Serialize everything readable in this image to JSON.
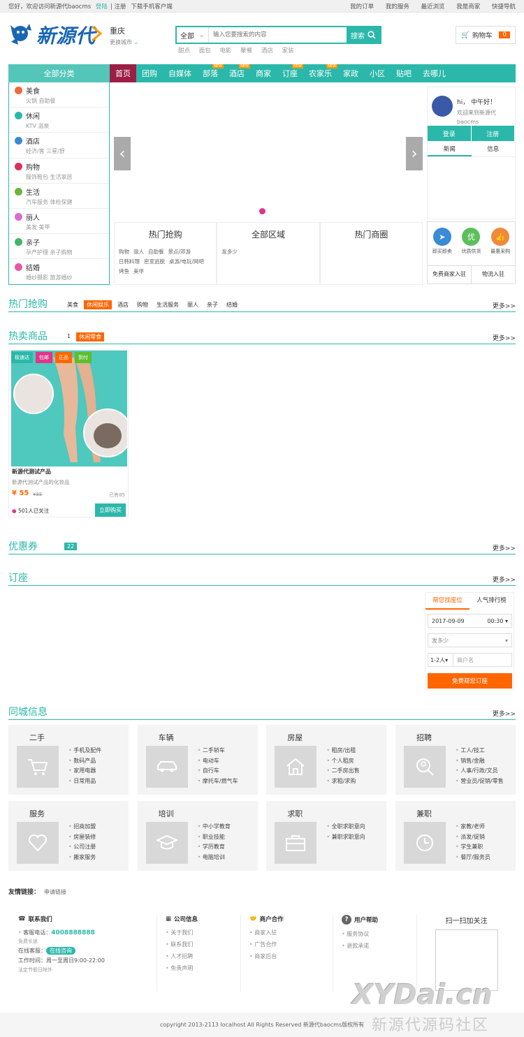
{
  "topbar": {
    "greet": "您好，欢迎访问新源代baocms",
    "login": "登陆",
    "register": "注册",
    "app": "下载手机客户端",
    "orders": "我的订单",
    "service": "我的服务",
    "recent": "最近浏览",
    "merchant": "我是商家",
    "quicknav": "快捷导航"
  },
  "header": {
    "logo": "新源代",
    "city": "重庆",
    "change_city": "更换城市",
    "search_cat": "全部",
    "search_placeholder": "输入您要搜索的内容",
    "search_btn": "搜索",
    "hotwords": [
      "甜点",
      "面包",
      "电影",
      "聚餐",
      "酒店",
      "家装"
    ],
    "cart": "购物车",
    "cart_count": "0"
  },
  "nav": {
    "all": "全部分类",
    "items": [
      "首页",
      "团购",
      "自媒体",
      "部落",
      "酒店",
      "商家",
      "订座",
      "农家乐",
      "家政",
      "小区",
      "贴吧",
      "去哪儿"
    ],
    "new_tag": "NEW"
  },
  "cats": [
    {
      "t": "美食",
      "s": "火锅  自助餐",
      "c": "#f06a35"
    },
    {
      "t": "休闲",
      "s": "KTV  温泉",
      "c": "#2bb8aa"
    },
    {
      "t": "酒店",
      "s": "经济/客  三星/舒",
      "c": "#3a8ad6"
    },
    {
      "t": "购物",
      "s": "服饰鞋包  生活家居",
      "c": "#d8335b"
    },
    {
      "t": "生活",
      "s": "汽车服务  体检保健",
      "c": "#6cb43c"
    },
    {
      "t": "丽人",
      "s": "美发  美甲",
      "c": "#d66cd4"
    },
    {
      "t": "亲子",
      "s": "孕产护理  亲子购物",
      "c": "#45b36b"
    },
    {
      "t": "结婚",
      "s": "婚纱摄影  旅游婚纱",
      "c": "#e957a5"
    }
  ],
  "trio": [
    {
      "h": "热门抢购",
      "k": [
        "购物",
        "丽人",
        "自助餐",
        "景点/郊游",
        "日韩料理",
        "密室逃脱",
        "桌游/电玩/网吧",
        "烤鱼",
        "美甲"
      ]
    },
    {
      "h": "全部区域",
      "k": [
        "发多少"
      ]
    },
    {
      "h": "热门商圈",
      "k": []
    }
  ],
  "user": {
    "hi": "hi，  中午好！",
    "welcome": "欢迎来到新源代baocms",
    "login": "登录",
    "register": "注册",
    "tab1": "新闻",
    "tab2": "信息"
  },
  "svc": {
    "items": [
      "即买即卖",
      "优质供货",
      "最惠采购"
    ],
    "you": "优",
    "b1": "免费商家入驻",
    "b2": "物流入驻"
  },
  "sections": {
    "hot": "热门抢购",
    "hot_tags": [
      "美食",
      "休闲娱乐",
      "酒店",
      "购物",
      "生活服务",
      "丽人",
      "亲子",
      "结婚"
    ],
    "sell": "热卖商品",
    "sell_num": "1",
    "sell_tag": "休闲零食",
    "coupon": "优惠券",
    "coupon_num": "22",
    "booking": "订座",
    "city": "同城信息",
    "more": "更多>>"
  },
  "product": {
    "badges": [
      "极速达",
      "包邮",
      "正品",
      "到付"
    ],
    "name": "新源代测试产品",
    "desc": "新源代测试产品的化妆品",
    "price": "¥ 55",
    "old": "¥85",
    "sold": "已售85",
    "follow": "501人已关注",
    "buy": "立即购买"
  },
  "booking": {
    "tab1": "帮您找座位",
    "tab2": "人气排行榜",
    "date": "2017-09-09",
    "time": "00:30",
    "area": "发多少",
    "people": "1-2人",
    "shop": "商户名",
    "go": "免费帮您订座"
  },
  "city": [
    {
      "t": "二手",
      "l": [
        "手机及配件",
        "数码产品",
        "家用电器",
        "日常用品"
      ]
    },
    {
      "t": "车辆",
      "l": [
        "二手轿车",
        "电动车",
        "自行车",
        "摩托车/燃气车"
      ]
    },
    {
      "t": "房屋",
      "l": [
        "租房/出租",
        "个人租房",
        "二手房出售",
        "求租/求购"
      ]
    },
    {
      "t": "招聘",
      "l": [
        "工人/技工",
        "销售/金融",
        "人事/行政/文员",
        "营业员/促销/零售"
      ]
    },
    {
      "t": "服务",
      "l": [
        "招商加盟",
        "房屋装修",
        "公司注册",
        "搬家服务"
      ]
    },
    {
      "t": "培训",
      "l": [
        "中小学教育",
        "职业技能",
        "学历教育",
        "电脑培训"
      ]
    },
    {
      "t": "求职",
      "l": [
        "全职求职意向",
        "兼职求职意向"
      ]
    },
    {
      "t": "兼职",
      "l": [
        "家教/老师",
        "派发/促销",
        "学生兼职",
        "餐厅/服务员"
      ]
    }
  ],
  "links": {
    "title": "友情链接：",
    "apply": "申请链接"
  },
  "footer": {
    "contact": "联系我们",
    "phone_label": "客服电话：",
    "phone": "4008888888",
    "free": "免费长途",
    "online": "在线客服：",
    "online_btn": "在线咨询",
    "hours": "工作时间：周一至周日9:00-22:00",
    "holiday": "法定节假日除外",
    "company": "公司信息",
    "company_l": [
      "关于我们",
      "联系我们",
      "人才招聘",
      "免责声明"
    ],
    "biz": "商户合作",
    "biz_l": [
      "商家入驻",
      "广告合作",
      "商家后台"
    ],
    "help": "用户帮助",
    "help_l": [
      "服务协议",
      "退款承诺"
    ],
    "scan": "扫一扫加关注"
  },
  "copyright": "copyright 2013-2113 localhost All Rights Reserved 新源代baocms版权所有",
  "watermark": "XYDai.cn",
  "watermark2": "新源代源码社区"
}
